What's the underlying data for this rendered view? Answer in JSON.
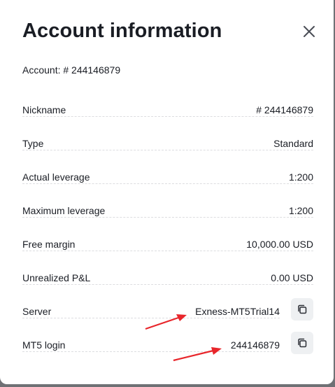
{
  "dialog": {
    "title": "Account information",
    "account_line": "Account: # 244146879",
    "close_icon": "close-icon"
  },
  "rows": [
    {
      "label": "Nickname",
      "value": "# 244146879"
    },
    {
      "label": "Type",
      "value": "Standard"
    },
    {
      "label": "Actual leverage",
      "value": "1:200"
    },
    {
      "label": "Maximum leverage",
      "value": "1:200"
    },
    {
      "label": "Free margin",
      "value": "10,000.00 USD"
    },
    {
      "label": "Unrealized P&L",
      "value": "0.00 USD"
    },
    {
      "label": "Server",
      "value": "Exness-MT5Trial14",
      "icon": "copy-icon"
    },
    {
      "label": "MT5 login",
      "value": "244146879",
      "icon": "copy-icon"
    }
  ],
  "colors": {
    "text": "#1a1d24",
    "copy_button_bg": "#eef0f2",
    "annotation_arrow": "#e8262b",
    "overlay": "#6f7175"
  }
}
